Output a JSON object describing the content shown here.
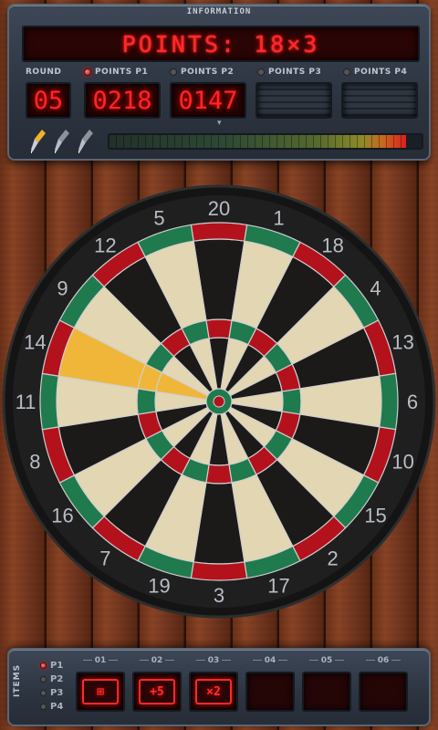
{
  "header": {
    "caption": "INFORMATION",
    "points_text": "POINTS: 18×3"
  },
  "scoreboard": {
    "round_label": "ROUND",
    "round_value": "05",
    "players": [
      {
        "label": "POINTS P1",
        "value": "0218",
        "active": true
      },
      {
        "label": "POINTS P2",
        "value": "0147",
        "active": false
      },
      {
        "label": "POINTS P3",
        "value": "",
        "active": false
      },
      {
        "label": "POINTS P4",
        "value": "",
        "active": false
      }
    ]
  },
  "throw_status": {
    "darts_icons": [
      "dart-thrown-icon",
      "dart-remaining-icon",
      "dart-remaining-icon"
    ],
    "power_level": 0.95
  },
  "dartboard": {
    "numbers": [
      "20",
      "1",
      "18",
      "4",
      "13",
      "6",
      "10",
      "15",
      "2",
      "17",
      "3",
      "19",
      "7",
      "16",
      "8",
      "11",
      "14",
      "9",
      "12",
      "5"
    ],
    "highlighted_number": "14",
    "colors": {
      "dark": "#1c1a18",
      "light": "#e3d6b2",
      "red": "#b3121d",
      "green": "#1f7a4d",
      "highlight": "#f0b63a"
    }
  },
  "items_panel": {
    "caption": "ITEMS",
    "players": [
      "P1",
      "P2",
      "P3",
      "P4"
    ],
    "active_player": "P1",
    "slots": [
      {
        "label": "01",
        "icon": "target-grid-icon",
        "text": "⊞"
      },
      {
        "label": "02",
        "icon": "plus-five-icon",
        "text": "+5"
      },
      {
        "label": "03",
        "icon": "times-two-icon",
        "text": "×2"
      },
      {
        "label": "04",
        "icon": "",
        "text": ""
      },
      {
        "label": "05",
        "icon": "",
        "text": ""
      },
      {
        "label": "06",
        "icon": "",
        "text": ""
      }
    ]
  }
}
